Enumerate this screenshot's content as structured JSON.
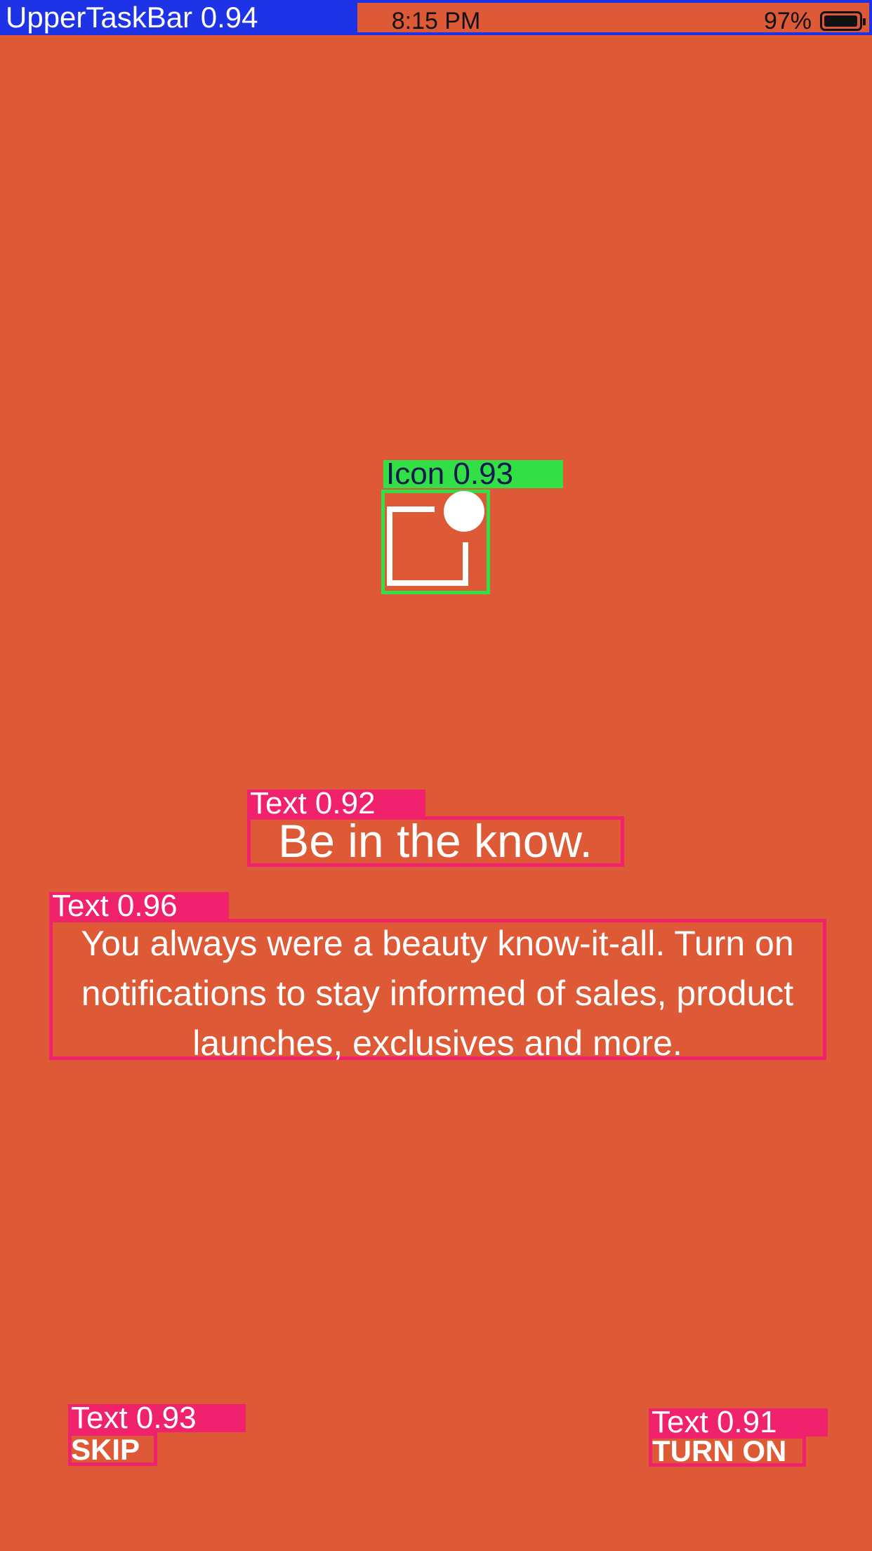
{
  "status_bar": {
    "annotation": "UpperTaskBar  0.94",
    "time": "8:15 PM",
    "battery_percent": "97%",
    "battery_level": 0.97
  },
  "icon": {
    "semantic": "notification-bell-icon",
    "annotation": "Icon  0.93"
  },
  "headline": {
    "annotation": "Text  0.92",
    "text": "Be in the know."
  },
  "body": {
    "annotation": "Text  0.96",
    "text": "You always were a beauty know-it-all. Turn on notifications to stay informed of sales, product launches, exclusives and more."
  },
  "actions": {
    "skip": {
      "annotation": "Text  0.93",
      "label": "SKIP"
    },
    "turn_on": {
      "annotation": "Text  0.91",
      "label": "TURN ON"
    }
  },
  "colors": {
    "background": "#DE5A36",
    "annotation_pink": "#F0226E",
    "annotation_green": "#32DF44",
    "annotation_blue": "#1E33E6",
    "text": "#FFFFFF"
  }
}
